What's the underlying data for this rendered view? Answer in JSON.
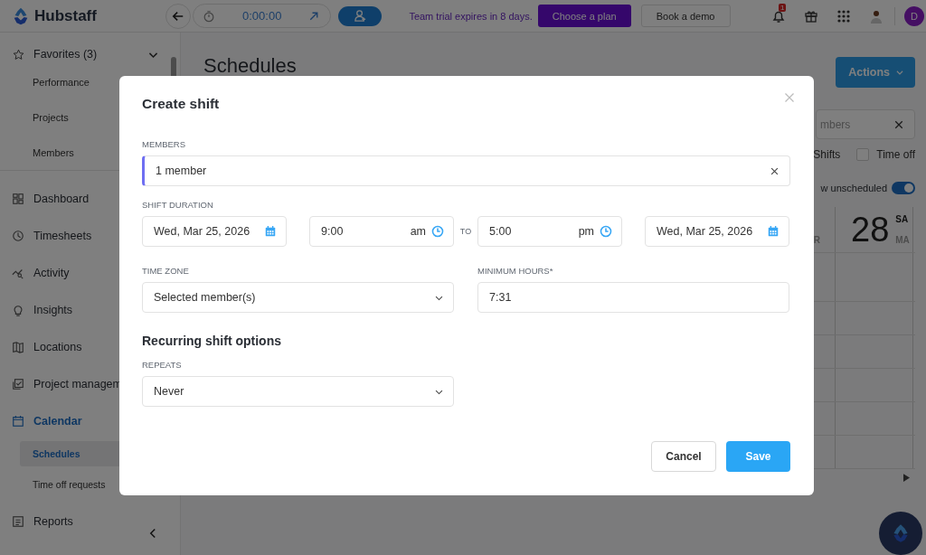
{
  "topbar": {
    "logo": "Hubstaff",
    "timer": "0:00:00",
    "trial_notice": "Team trial expires in 8 days.",
    "buttons": [
      {
        "label": "Choose a plan",
        "kind": "primary"
      },
      {
        "label": "Book a demo",
        "kind": "secondary"
      }
    ],
    "notification_count": "1",
    "avatar_initial": "D"
  },
  "sidebar": {
    "favorites": {
      "label": "Favorites (3)",
      "expanded": true,
      "items": [
        {
          "label": "Performance"
        },
        {
          "label": "Projects"
        },
        {
          "label": "Members"
        }
      ]
    },
    "items": [
      {
        "label": "Dashboard",
        "selected": false
      },
      {
        "label": "Timesheets",
        "selected": false
      },
      {
        "label": "Activity",
        "selected": false
      },
      {
        "label": "Insights",
        "selected": false
      },
      {
        "label": "Locations",
        "selected": false
      },
      {
        "label": "Project managem",
        "selected": false
      },
      {
        "label": "Calendar",
        "selected": true,
        "children": [
          {
            "label": "Schedules",
            "selected": true
          },
          {
            "label": "Time off requests",
            "selected": false
          }
        ]
      },
      {
        "label": "Reports",
        "selected": false
      }
    ]
  },
  "page": {
    "title": "Schedules",
    "actions": "Actions",
    "search": {
      "placeholder": "mbers"
    },
    "filters": [
      {
        "label": "Shifts"
      },
      {
        "label": "Time off",
        "checked": false
      }
    ],
    "toggle": {
      "label": "w unscheduled",
      "on": true
    },
    "calendar": {
      "prev_column_label": "R",
      "date": "28",
      "weekday": "SA",
      "month": "MA"
    }
  },
  "modal": {
    "title": "Create shift",
    "members": {
      "label": "MEMBERS",
      "value": "1 member"
    },
    "shift_duration": {
      "label": "SHIFT DURATION",
      "start_date": "Wed, Mar 25, 2026",
      "start_time": "9:00",
      "start_period": "am",
      "separator": "TO",
      "end_time": "5:00",
      "end_period": "pm",
      "end_date": "Wed, Mar 25, 2026"
    },
    "time_zone": {
      "label": "TIME ZONE",
      "value": "Selected member(s)"
    },
    "minimum_hours": {
      "label": "MINIMUM HOURS*",
      "value": "7:31"
    },
    "recurring": {
      "heading": "Recurring shift options",
      "label": "REPEATS",
      "value": "Never"
    },
    "buttons": [
      {
        "label": "Cancel",
        "kind": "secondary"
      },
      {
        "label": "Save",
        "kind": "primary"
      }
    ]
  }
}
